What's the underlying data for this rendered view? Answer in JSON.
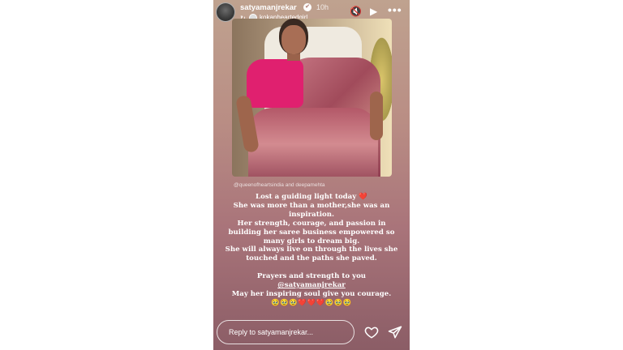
{
  "header": {
    "username": "satyamanjrekar",
    "verified_glyph": "✔",
    "time": "10h",
    "repost_icon": "repost-icon",
    "reposted_from": "kokanheartedgirl"
  },
  "controls": {
    "mute_glyph": "🔇",
    "play_glyph": "▶",
    "more_glyph": "•••"
  },
  "photo_credit": "@queenofheartsindia and deepamehta",
  "caption": {
    "line1": "Lost a guiding light today ❤️",
    "line2": "She was more than a mother,she was an inspiration.",
    "line3": "Her strength, courage, and passion in building her saree business empowered so many girls to dream big.",
    "line4": "She will always live on through the lives she touched and the paths she paved.",
    "line5": "Prayers and strength to you",
    "mention": "@satyamanjrekar",
    "line6": "May her inspiring soul give you courage.",
    "emojis": "🥹🥹🥹❤️❤️❤️🥹🥹🥹"
  },
  "reply": {
    "placeholder": "Reply to satyamanjrekar..."
  },
  "colors": {
    "background": "#ffffff",
    "story_top": "#bfa28f",
    "story_bottom": "#8b5d66"
  }
}
